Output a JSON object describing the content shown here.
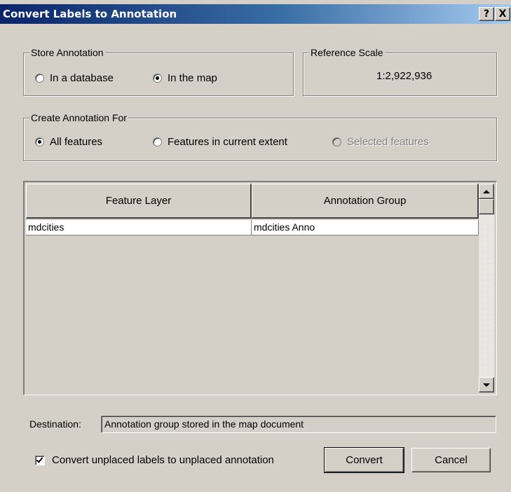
{
  "window": {
    "title": "Convert Labels to Annotation",
    "help_label": "?",
    "close_label": "X"
  },
  "store_annotation": {
    "legend": "Store Annotation",
    "options": [
      {
        "label": "In a database",
        "checked": false
      },
      {
        "label": "In the map",
        "checked": true
      }
    ]
  },
  "reference_scale": {
    "legend": "Reference Scale",
    "value": "1:2,922,936"
  },
  "create_for": {
    "legend": "Create Annotation For",
    "options": [
      {
        "label": "All features",
        "checked": true,
        "enabled": true
      },
      {
        "label": "Features in current extent",
        "checked": false,
        "enabled": true
      },
      {
        "label": "Selected features",
        "checked": false,
        "enabled": false
      }
    ]
  },
  "grid": {
    "columns": [
      "Feature Layer",
      "Annotation Group"
    ],
    "rows": [
      [
        "mdcities",
        "mdcities Anno"
      ]
    ]
  },
  "destination": {
    "label": "Destination:",
    "value": "Annotation group stored in the map document"
  },
  "convert_unplaced": {
    "label": "Convert unplaced labels to unplaced annotation",
    "checked": true
  },
  "buttons": {
    "convert": "Convert",
    "cancel": "Cancel"
  }
}
